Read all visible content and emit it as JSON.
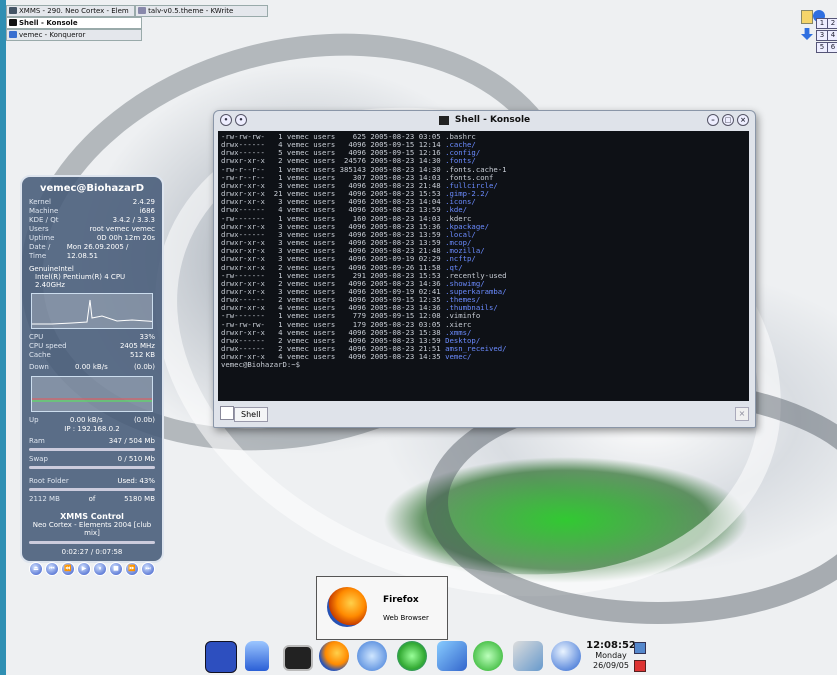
{
  "taskbar": {
    "tasks": [
      {
        "label": "XMMS - 290. Neo Cortex - Elem",
        "active": false
      },
      {
        "label": "talv-v0.5.theme - KWrite",
        "active": false
      },
      {
        "label": "Shell - Konsole",
        "active": true
      },
      {
        "label": "vemec - Konqueror",
        "active": false
      }
    ],
    "pager": [
      "1",
      "2",
      "3",
      "4",
      "5",
      "6"
    ]
  },
  "sysmon": {
    "title": "vemec@BiohazarD",
    "kernel_label": "Kernel",
    "kernel": "2.4.29",
    "machine_label": "Machine",
    "machine": "i686",
    "kde_label": "KDE / Qt",
    "kde": "3.4.2  / 3.3.3",
    "users_label": "Users",
    "users": "root vemec vemec",
    "uptime_label": "Uptime",
    "uptime": "0D  00h 12m 20s",
    "datetime_label": "Date / Time",
    "datetime": "Mon 26.09.2005 / 12.08.51",
    "cpu_vendor": "GenuineIntel",
    "cpu_model": "Intel(R) Pentium(R) 4 CPU 2.40GHz",
    "cpu_label": "CPU",
    "cpu": "33%",
    "cpuspeed_label": "CPU speed",
    "cpuspeed": "2405 MHz",
    "cache_label": "Cache",
    "cache": "512 KB",
    "down_label": "Down",
    "down": "0.00 kB/s",
    "down_total": "(0.0b)",
    "up_label": "Up",
    "up": "0.00 kB/s",
    "up_total": "(0.0b)",
    "ip": "IP : 192.168.0.2",
    "ram_label": "Ram",
    "ram": "347 / 504 Mb",
    "swap_label": "Swap",
    "swap": "0 / 510 Mb",
    "root_label": "Root Folder",
    "root_used": "Used: 43%",
    "root_used_mb": "2112 MB",
    "root_of": "of",
    "root_total_mb": "5180 MB",
    "xmms_title": "XMMS Control",
    "xmms_track": "Neo Cortex - Elements 2004 [club mix]",
    "xmms_time": "0:02:27 / 0:07:58"
  },
  "konsole": {
    "title": "Shell - Konsole",
    "lines": [
      {
        "text": "-rw-rw-rw-   1 vemec users    625 2005-08-23 03:05 ",
        "name": ".bashrc",
        "dir": false
      },
      {
        "text": "drwx------   4 vemec users   4096 2005-09-15 12:14 ",
        "name": ".cache/",
        "dir": true
      },
      {
        "text": "drwx------   5 vemec users   4096 2005-09-15 12:16 ",
        "name": ".config/",
        "dir": true
      },
      {
        "text": "drwxr-xr-x   2 vemec users  24576 2005-08-23 14:30 ",
        "name": ".fonts/",
        "dir": true
      },
      {
        "text": "-rw-r--r--   1 vemec users 385143 2005-08-23 14:30 ",
        "name": ".fonts.cache-1",
        "dir": false
      },
      {
        "text": "-rw-r--r--   1 vemec users    307 2005-08-23 14:03 ",
        "name": ".fonts.conf",
        "dir": false
      },
      {
        "text": "drwxr-xr-x   3 vemec users   4096 2005-08-23 21:48 ",
        "name": ".fullcircle/",
        "dir": true
      },
      {
        "text": "drwxr-xr-x  21 vemec users   4096 2005-08-23 15:53 ",
        "name": ".gimp-2.2/",
        "dir": true
      },
      {
        "text": "drwxr-xr-x   3 vemec users   4096 2005-08-23 14:04 ",
        "name": ".icons/",
        "dir": true
      },
      {
        "text": "drwx------   4 vemec users   4096 2005-08-23 13:59 ",
        "name": ".kde/",
        "dir": true
      },
      {
        "text": "-rw-------   1 vemec users    160 2005-08-23 14:03 ",
        "name": ".kderc",
        "dir": false
      },
      {
        "text": "drwxr-xr-x   3 vemec users   4096 2005-08-23 15:36 ",
        "name": ".kpackage/",
        "dir": true
      },
      {
        "text": "drwx------   3 vemec users   4096 2005-08-23 13:59 ",
        "name": ".local/",
        "dir": true
      },
      {
        "text": "drwxr-xr-x   3 vemec users   4096 2005-08-23 13:59 ",
        "name": ".mcop/",
        "dir": true
      },
      {
        "text": "drwxr-xr-x   3 vemec users   4096 2005-08-23 21:48 ",
        "name": ".mozilla/",
        "dir": true
      },
      {
        "text": "drwxr-xr-x   3 vemec users   4096 2005-09-19 02:29 ",
        "name": ".ncftp/",
        "dir": true
      },
      {
        "text": "drwxr-xr-x   2 vemec users   4096 2005-09-26 11:58 ",
        "name": ".qt/",
        "dir": true
      },
      {
        "text": "-rw-------   1 vemec users    291 2005-08-23 15:53 ",
        "name": ".recently-used",
        "dir": false
      },
      {
        "text": "drwxr-xr-x   2 vemec users   4096 2005-08-23 14:36 ",
        "name": ".showimg/",
        "dir": true
      },
      {
        "text": "drwxr-xr-x   3 vemec users   4096 2005-09-19 02:41 ",
        "name": ".superkaramba/",
        "dir": true
      },
      {
        "text": "drwx------   2 vemec users   4096 2005-09-15 12:35 ",
        "name": ".themes/",
        "dir": true
      },
      {
        "text": "drwxr-xr-x   4 vemec users   4096 2005-08-23 14:36 ",
        "name": ".thumbnails/",
        "dir": true
      },
      {
        "text": "-rw-------   1 vemec users    779 2005-09-15 12:08 ",
        "name": ".viminfo",
        "dir": false
      },
      {
        "text": "-rw-rw-rw-   1 vemec users    179 2005-08-23 03:05 ",
        "name": ".xierc",
        "dir": false
      },
      {
        "text": "drwxr-xr-x   4 vemec users   4096 2005-08-23 15:38 ",
        "name": ".xmms/",
        "dir": true
      },
      {
        "text": "drwx------   2 vemec users   4096 2005-08-23 13:59 ",
        "name": "Desktop/",
        "dir": true
      },
      {
        "text": "drwx------   2 vemec users   4096 2005-08-23 21:51 ",
        "name": "amsn_received/",
        "dir": true
      },
      {
        "text": "drwxr-xr-x   4 vemec users   4096 2005-08-23 14:35 ",
        "name": "vemec/",
        "dir": true
      }
    ],
    "prompt": "vemec@BiohazarD:~$",
    "tab_label": "Shell"
  },
  "tooltip": {
    "app_name": "Firefox",
    "app_desc": "Web Browser"
  },
  "clock": {
    "time": "12:08:52",
    "day": "Monday",
    "date": "26/09/05"
  },
  "colors": {
    "terminal_bg": "#0e1116",
    "dir_color": "#6b8bff",
    "panel_accent": "#3a5fc8"
  },
  "panel_icons": [
    "kde-menu-icon",
    "disk-icon",
    "terminal-icon",
    "firefox-icon",
    "kopete-icon",
    "users-icon",
    "network-icon",
    "equalizer-icon",
    "tools-icon",
    "globe-icon"
  ]
}
